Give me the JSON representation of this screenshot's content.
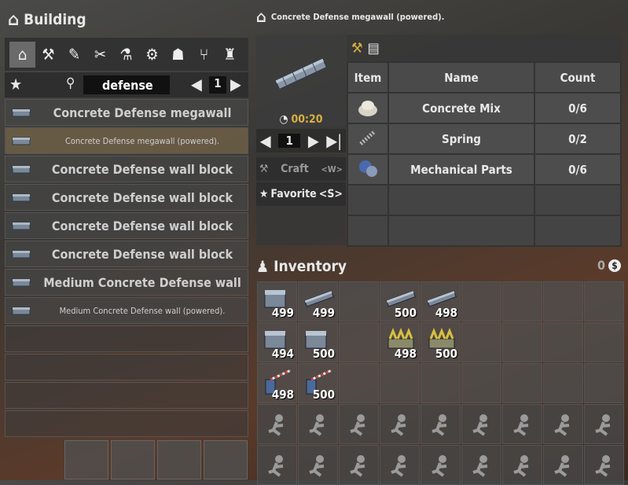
{
  "left": {
    "title": "Building",
    "search_value": "defense",
    "page": "1"
  },
  "categories": [
    {
      "name": "category-home-icon",
      "glyph": "⌂"
    },
    {
      "name": "category-build-icon",
      "glyph": "⚒"
    },
    {
      "name": "category-weapons-icon",
      "glyph": "✎"
    },
    {
      "name": "category-tools-icon",
      "glyph": "✂"
    },
    {
      "name": "category-science-icon",
      "glyph": "⚗"
    },
    {
      "name": "category-parts-icon",
      "glyph": "⚙"
    },
    {
      "name": "category-clothing-icon",
      "glyph": "☗"
    },
    {
      "name": "category-food-icon",
      "glyph": "⑂"
    },
    {
      "name": "category-furniture-icon",
      "glyph": "♜"
    }
  ],
  "recipes": [
    {
      "label": "Concrete Defense megawall",
      "small": false,
      "selected": false
    },
    {
      "label": "Concrete Defense megawall (powered).",
      "small": true,
      "selected": true
    },
    {
      "label": "Concrete Defense wall block",
      "small": false,
      "selected": false
    },
    {
      "label": "Concrete Defense wall block",
      "small": false,
      "selected": false
    },
    {
      "label": "Concrete Defense wall block",
      "small": false,
      "selected": false
    },
    {
      "label": "Concrete Defense wall block",
      "small": false,
      "selected": false
    },
    {
      "label": "Medium Concrete Defense wall",
      "small": false,
      "selected": false
    },
    {
      "label": "Medium Concrete Defense wall (powered).",
      "small": true,
      "selected": false
    },
    {
      "label": "",
      "small": false,
      "selected": false
    },
    {
      "label": "",
      "small": false,
      "selected": false
    },
    {
      "label": "",
      "small": false,
      "selected": false
    },
    {
      "label": "",
      "small": false,
      "selected": false
    }
  ],
  "detail": {
    "title": "Concrete Defense megawall (powered).",
    "craft_time": "00:20",
    "quantity": "1",
    "craft_label": "Craft",
    "craft_key": "<W>",
    "favorite_label": "Favorite",
    "favorite_key": "<S>"
  },
  "ingredients": {
    "headers": {
      "item": "Item",
      "name": "Name",
      "count": "Count"
    },
    "rows": [
      {
        "name": "Concrete Mix",
        "count": "0/6"
      },
      {
        "name": "Spring",
        "count": "0/2"
      },
      {
        "name": "Mechanical Parts",
        "count": "0/6"
      }
    ]
  },
  "inventory": {
    "title": "Inventory",
    "money": "0",
    "slots": [
      {
        "count": "499",
        "icon": "block"
      },
      {
        "count": "499",
        "icon": "wall"
      },
      {
        "count": "",
        "icon": ""
      },
      {
        "count": "500",
        "icon": "wall"
      },
      {
        "count": "498",
        "icon": "wall"
      },
      {
        "count": "",
        "icon": ""
      },
      {
        "count": "",
        "icon": ""
      },
      {
        "count": "",
        "icon": ""
      },
      {
        "count": "",
        "icon": ""
      },
      {
        "count": "494",
        "icon": "block"
      },
      {
        "count": "500",
        "icon": "block"
      },
      {
        "count": "",
        "icon": ""
      },
      {
        "count": "498",
        "icon": "spikes"
      },
      {
        "count": "500",
        "icon": "spikes"
      },
      {
        "count": "",
        "icon": ""
      },
      {
        "count": "",
        "icon": ""
      },
      {
        "count": "",
        "icon": ""
      },
      {
        "count": "",
        "icon": ""
      },
      {
        "count": "498",
        "icon": "barrier"
      },
      {
        "count": "500",
        "icon": "barrier"
      },
      {
        "count": "",
        "icon": ""
      },
      {
        "count": "",
        "icon": ""
      },
      {
        "count": "",
        "icon": ""
      },
      {
        "count": "",
        "icon": ""
      },
      {
        "count": "",
        "icon": ""
      },
      {
        "count": "",
        "icon": ""
      },
      {
        "count": "",
        "icon": ""
      }
    ],
    "locked_rows": 2
  }
}
